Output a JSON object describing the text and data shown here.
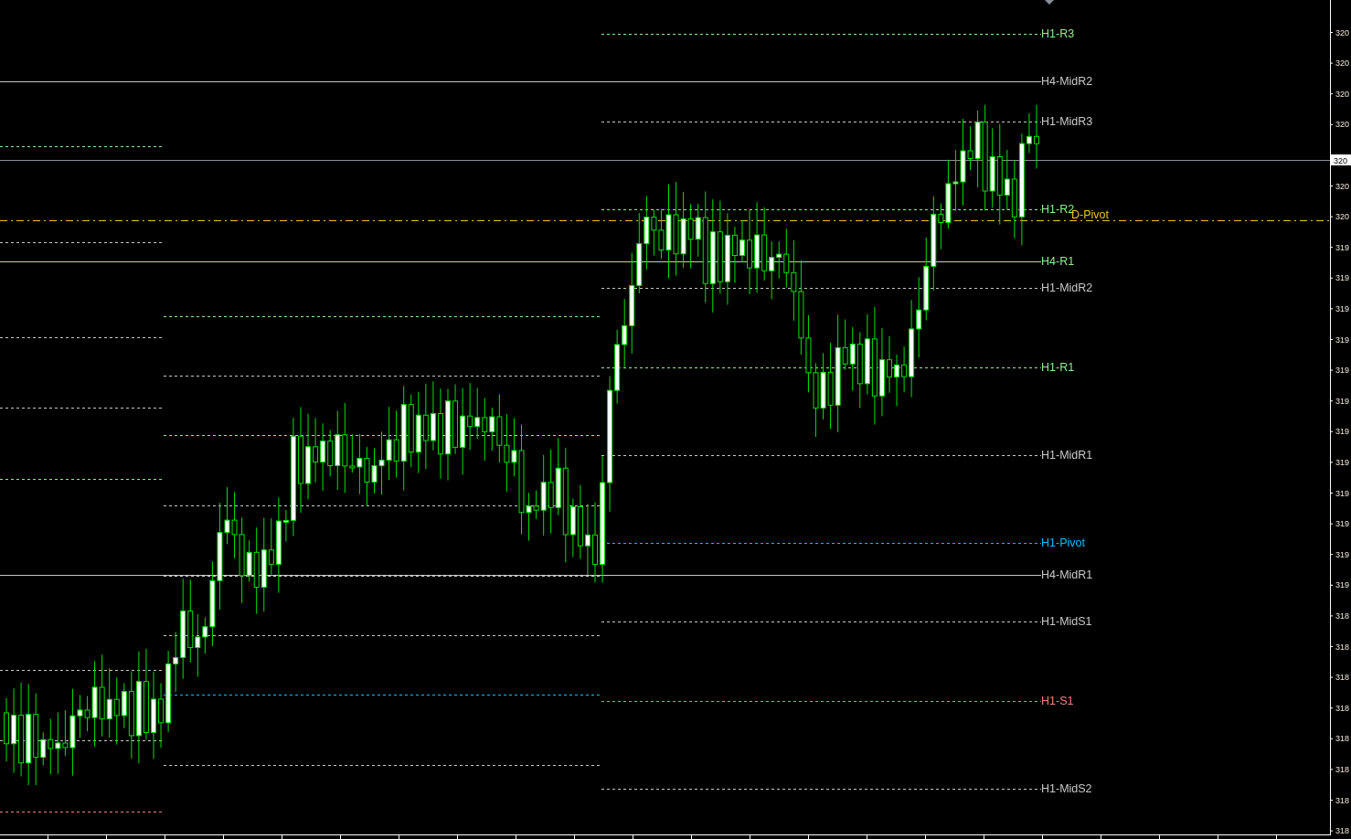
{
  "chart": {
    "levels": [
      {
        "label": "H1-R3",
        "color": "#90ee90",
        "kind": "dotted"
      },
      {
        "label": "H4-MidR2",
        "color": "#c8c8c8",
        "kind": "solid"
      },
      {
        "label": "H1-MidR3",
        "color": "#c8c8c8",
        "kind": "dotted"
      },
      {
        "label": "H1-R2",
        "color": "#90ee90",
        "kind": "dotted"
      },
      {
        "label": "D-Pivot",
        "color": "#f0c020",
        "kind": "dashdot"
      },
      {
        "label": "H4-R1",
        "color": "#90ee90",
        "kind": "solid"
      },
      {
        "label": "H1-MidR2",
        "color": "#c8c8c8",
        "kind": "dotted"
      },
      {
        "label": "H1-R1",
        "color": "#90ee90",
        "kind": "dotted"
      },
      {
        "label": "H1-MidR1",
        "color": "#c8c8c8",
        "kind": "dotted"
      },
      {
        "label": "H1-Pivot",
        "color": "#00bfff",
        "kind": "dotted"
      },
      {
        "label": "H4-MidR1",
        "color": "#c8c8c8",
        "kind": "solid"
      },
      {
        "label": "H1-MidS1",
        "color": "#c8c8c8",
        "kind": "dotted"
      },
      {
        "label": "H1-S1",
        "color": "#f08080",
        "kind": "dotted"
      },
      {
        "label": "H1-MidS2",
        "color": "#c8c8c8",
        "kind": "dotted"
      }
    ],
    "current_price": "320",
    "price_axis": [
      "320",
      "320",
      "320",
      "320",
      "320",
      "320",
      "319",
      "319",
      "319",
      "319",
      "319",
      "319",
      "319",
      "319",
      "319",
      "319",
      "319",
      "319",
      "318",
      "318",
      "318",
      "318",
      "318",
      "318",
      "318",
      "318"
    ]
  }
}
